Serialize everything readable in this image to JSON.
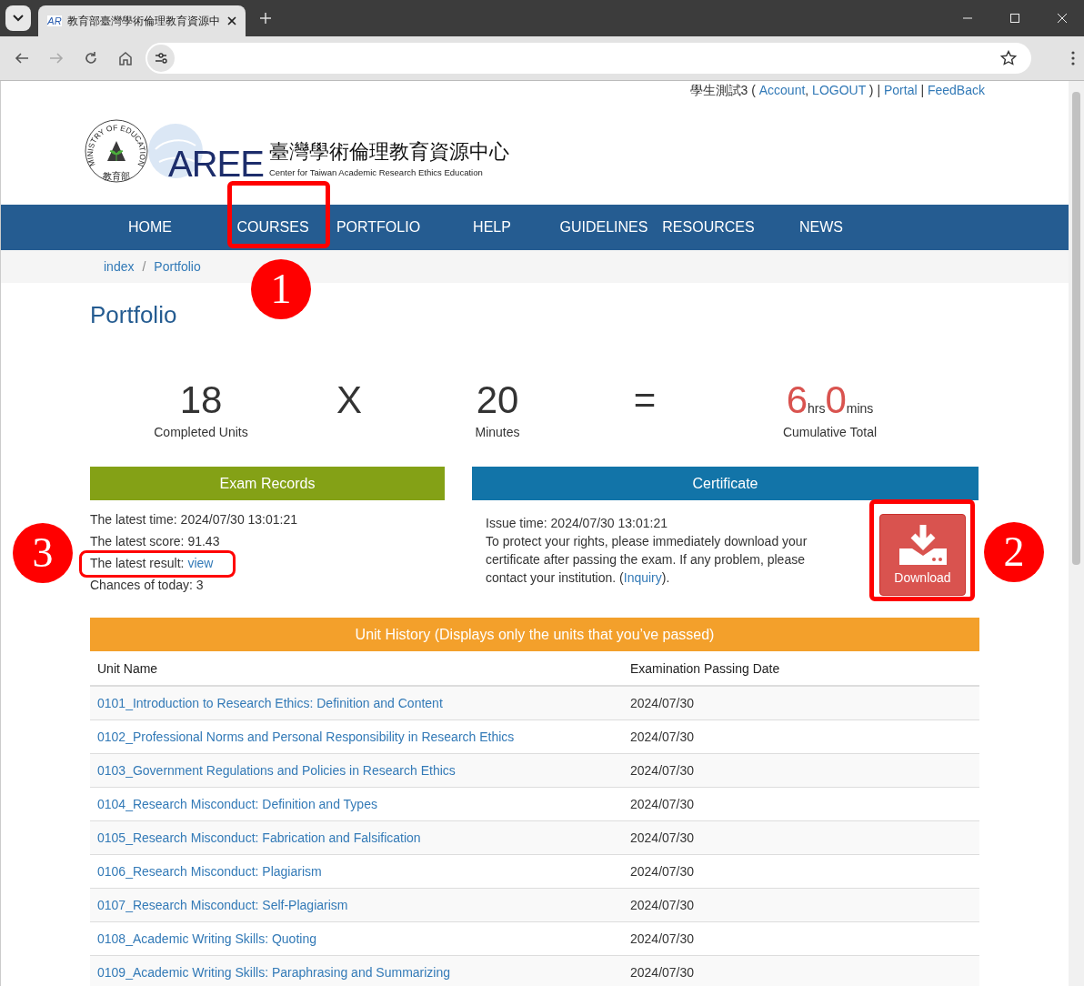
{
  "browser": {
    "tab_title": "教育部臺灣學術倫理教育資源中",
    "favicon_text": "AR"
  },
  "user_bar": {
    "user": "學生測試3 ( ",
    "account": "Account",
    "comma": ", ",
    "logout": "LOGOUT",
    "close": " ) | ",
    "portal": "Portal",
    "sep": " | ",
    "feedback": "FeedBack"
  },
  "logo": {
    "emblem_ring": "MINISTRY OF EDUCATION",
    "emblem_bottom": "教育部",
    "mark": "AREE",
    "name_zh": "臺灣學術倫理教育資源中心",
    "name_en": "Center for Taiwan Academic Research Ethics Education"
  },
  "nav": [
    "HOME",
    "COURSES",
    "PORTFOLIO",
    "HELP",
    "GUIDELINES",
    "RESOURCES",
    "NEWS"
  ],
  "breadcrumb": [
    {
      "label": "index"
    },
    {
      "label": "Portfolio"
    }
  ],
  "breadcrumb_separator": "/",
  "page_title": "Portfolio",
  "stats": {
    "units": "18",
    "units_label": "Completed Units",
    "times": "X",
    "minutes": "20",
    "minutes_label": "Minutes",
    "equals": "=",
    "hours": "6",
    "hours_unit": "hrs",
    "mins": "0",
    "mins_unit": "mins",
    "total_label": "Cumulative Total"
  },
  "exam_records": {
    "title": "Exam Records",
    "time": "The latest time: 2024/07/30 13:01:21",
    "score": "The latest score: 91.43",
    "result_label": "The latest result: ",
    "result_link": "view",
    "chances": "Chances of today: 3"
  },
  "certificate": {
    "title": "Certificate",
    "issue": "Issue time: 2024/07/30 13:01:21",
    "notice": "To protect your rights, please immediately download your certificate after passing the exam. If any problem, please contact your institution. (",
    "inquiry": "Inquiry",
    "notice_end": ").",
    "download": "Download"
  },
  "unit_history": {
    "title": "Unit History (Displays only the units that you’ve passed)",
    "columns": [
      "Unit Name",
      "Examination Passing Date"
    ],
    "rows": [
      {
        "unit": "0101_Introduction to Research Ethics: Definition and Content",
        "date": "2024/07/30"
      },
      {
        "unit": "0102_Professional Norms and Personal Responsibility in Research Ethics",
        "date": "2024/07/30"
      },
      {
        "unit": "0103_Government Regulations and Policies in Research Ethics",
        "date": "2024/07/30"
      },
      {
        "unit": "0104_Research Misconduct: Definition and Types",
        "date": "2024/07/30"
      },
      {
        "unit": "0105_Research Misconduct: Fabrication and Falsification",
        "date": "2024/07/30"
      },
      {
        "unit": "0106_Research Misconduct: Plagiarism",
        "date": "2024/07/30"
      },
      {
        "unit": "0107_Research Misconduct: Self-Plagiarism",
        "date": "2024/07/30"
      },
      {
        "unit": "0108_Academic Writing Skills: Quoting",
        "date": "2024/07/30"
      },
      {
        "unit": "0109_Academic Writing Skills: Paraphrasing and Summarizing",
        "date": "2024/07/30"
      }
    ]
  },
  "annotations": [
    {
      "number": "1"
    },
    {
      "number": "2"
    },
    {
      "number": "3"
    }
  ]
}
